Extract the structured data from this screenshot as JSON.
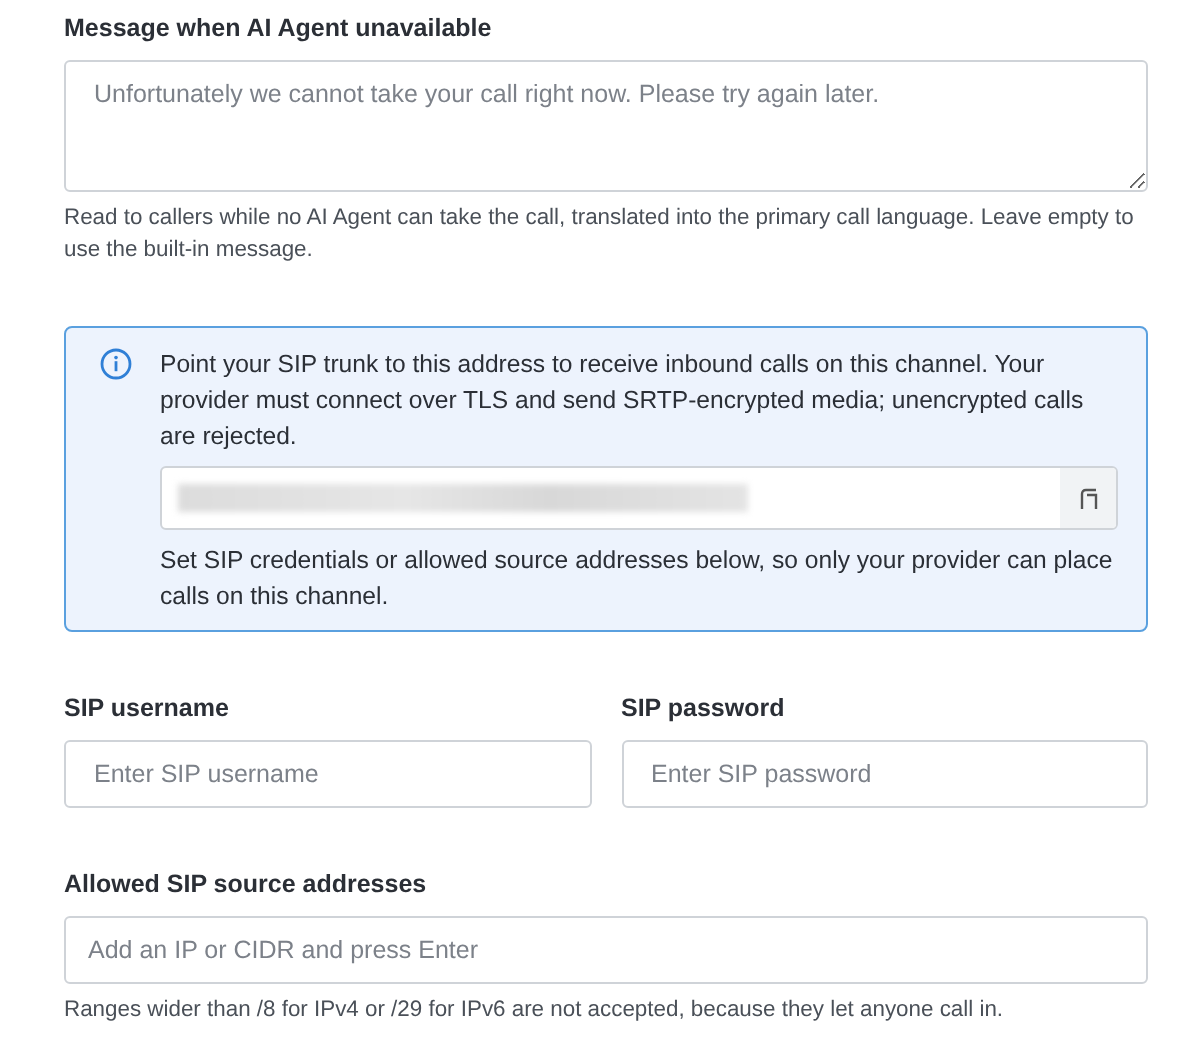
{
  "message_field": {
    "label": "Message when AI Agent unavailable",
    "placeholder": "Unfortunately we cannot take your call right now. Please try again later.",
    "help": "Read to callers while no AI Agent can take the call, translated into the primary call language. Leave empty to use the built-in message."
  },
  "info_box": {
    "text": "Point your SIP trunk to this address to receive inbound calls on this channel. Your provider must connect over TLS and send SRTP-encrypted media; unencrypted calls are rejected.",
    "address": {
      "redacted": true
    },
    "note": "Set SIP credentials or allowed source addresses below, so only your provider can place calls on this channel."
  },
  "credentials": [
    {
      "label": "SIP username",
      "placeholder": "Enter SIP username"
    },
    {
      "label": "SIP password",
      "placeholder": "Enter SIP password"
    }
  ],
  "sources_field": {
    "label": "Allowed SIP source addresses",
    "placeholder": "Add an IP or CIDR and press Enter",
    "help": "Ranges wider than /8 for IPv4 or /29 for IPv6 are not accepted, because they let anyone call in."
  }
}
